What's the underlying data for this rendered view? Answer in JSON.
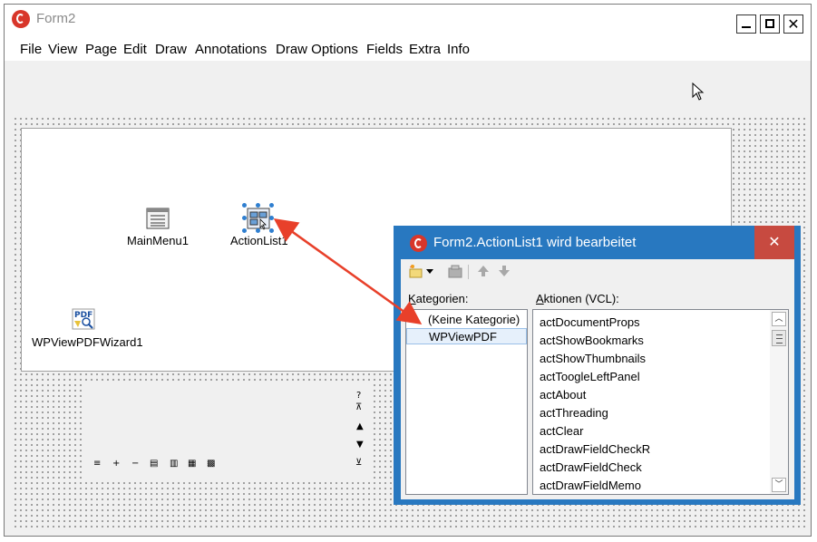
{
  "window": {
    "title": "Form2",
    "minimize": "",
    "close_glyph": "✕"
  },
  "menu": {
    "items": [
      "File",
      "View",
      "Page",
      "Edit",
      "Draw",
      "Annotations",
      "Draw Options",
      "Fields",
      "Extra",
      "Info"
    ]
  },
  "components": {
    "main_menu": "MainMenu1",
    "action_list": "ActionList1",
    "pdf_wizard": "WPViewPDFWizard1",
    "pdf_icon_text": "PDF"
  },
  "dialog": {
    "title": "Form2.ActionList1 wird bearbeitet",
    "close_glyph": "✕",
    "categories_label": "Kategorien:",
    "actions_label": "Aktionen (VCL):",
    "categories": [
      "(Keine Kategorie)",
      "WPViewPDF"
    ],
    "selected_category": 1,
    "actions": [
      "actDocumentProps",
      "actShowBookmarks",
      "actShowThumbnails",
      "actToogleLeftPanel",
      "actAbout",
      "actThreading",
      "actClear",
      "actDrawFieldCheckR",
      "actDrawFieldCheck",
      "actDrawFieldMemo"
    ]
  },
  "toolbar_glyphs": {
    "help": "?",
    "top": "⊼",
    "up": "▲",
    "down": "▼",
    "bottom": "⊻",
    "bar": [
      "≡",
      "+",
      "−",
      "▤",
      "▥",
      "▦",
      "▩"
    ]
  },
  "colors": {
    "dialog_frame": "#2878c0",
    "dialog_close": "#c74a40",
    "app_icon": "#d8362a",
    "arrow": "#e8402a"
  }
}
